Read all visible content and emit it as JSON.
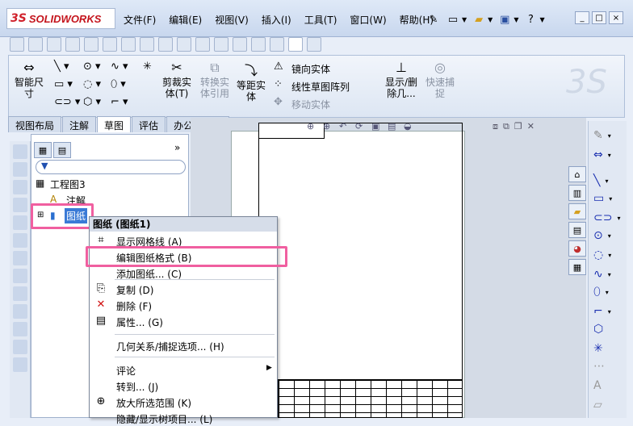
{
  "app": {
    "logo_prefix": "3S",
    "logo_text": "SOLIDWORKS"
  },
  "menu": [
    "文件(F)",
    "编辑(E)",
    "视图(V)",
    "插入(I)",
    "工具(T)",
    "窗口(W)",
    "帮助(H)"
  ],
  "quick_icons": [
    "pin-icon",
    "new-doc-icon",
    "open-icon",
    "save-icon",
    "help-icon"
  ],
  "window_buttons": [
    "_",
    "□",
    "×"
  ],
  "commands": {
    "smart_dim": "智能尺\n寸",
    "trim": "剪裁实\n体(T)",
    "convert": "转换实\n体引用",
    "offset": "等距实\n体",
    "mirror": "镜向实体",
    "linear_pattern": "线性草图阵列",
    "move": "移动实体",
    "display_delete": "显示/删\n除几...",
    "quick_snap": "快速捕\n捉"
  },
  "tabs": [
    "视图布局",
    "注解",
    "草图",
    "评估",
    "办公室产品"
  ],
  "active_tab": "草图",
  "tree": {
    "root": "工程图3",
    "annotations": "注解",
    "sheet": "图纸"
  },
  "context_menu": {
    "header": "图纸 (图纸1)",
    "items": [
      {
        "label": "显示网格线 (A)",
        "icon": "grid-icon"
      },
      {
        "label": "编辑图纸格式 (B)",
        "icon": "none",
        "highlighted": true
      },
      {
        "label": "添加图纸... (C)",
        "icon": "none"
      },
      {
        "label": "复制 (D)",
        "icon": "copy-icon"
      },
      {
        "label": "删除 (F)",
        "icon": "delete-icon"
      },
      {
        "label": "属性... (G)",
        "icon": "properties-icon"
      },
      {
        "label": "几何关系/捕捉选项... (H)",
        "icon": "none"
      },
      {
        "label": "评论",
        "icon": "none",
        "submenu": true
      },
      {
        "label": "转到... (J)",
        "icon": "none"
      },
      {
        "label": "放大所选范围 (K)",
        "icon": "zoom-icon"
      },
      {
        "label": "隐藏/显示树项目... (L)",
        "icon": "none"
      }
    ]
  },
  "colors": {
    "highlight": "#f05fa0",
    "accent_blue": "#1a2fb0",
    "logo_red": "#d0202a"
  }
}
